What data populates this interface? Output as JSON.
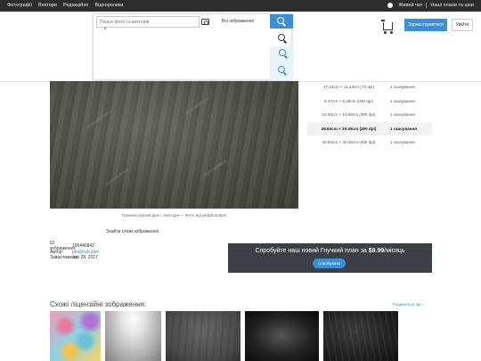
{
  "topbar": {
    "nav": [
      "Фотографії",
      "Вектори",
      "Редакційне",
      "Відеоролики"
    ],
    "chat_label": "Живий чат",
    "plans_label": "Наші плани та ціни"
  },
  "search": {
    "placeholder": "Пошук фото та векторів",
    "category": "Всі зображення"
  },
  "header": {
    "register_label": "Зареєструватися",
    "login_label": "Увійти"
  },
  "image": {
    "watermark": "depositphotos",
    "caption": "Тканина хороий фон і текстури — Фото від pedphoto3pm",
    "similar_link": "Знайти схожі зображення"
  },
  "sizes": [
    {
      "dim": "17.64cm × 11.43cm (72 dpi)",
      "dl": "1 скачування",
      "selected": false
    },
    {
      "dim": "8.47cm × 5.49cm (300 dpi)",
      "dl": "1 скачування",
      "selected": false
    },
    {
      "dim": "16.93cm × 10.98cm (300 dpi)",
      "dl": "1 скачування",
      "selected": false
    },
    {
      "dim": "46.94cm × 30.45cm (300 dpi)",
      "dl": "1 скачування",
      "selected": true
    },
    {
      "dim": "46.94cm × 30.45cm (300 dpi)",
      "dl": "1 скачування",
      "selected": false
    }
  ],
  "meta": {
    "id_label": "ID зображення:",
    "id_value": "166440842",
    "author_label": "Автор:",
    "author_value": "pedphoto3pm",
    "uploaded_label": "Завантажено:",
    "uploaded_value": "Jun 28, 2017"
  },
  "promo": {
    "text_prefix": "Спробуйте наш новий Гнучкий план за ",
    "price": "$9.99",
    "text_suffix": "/місяць",
    "button_label": "Спробувати"
  },
  "similar": {
    "title": "Схожі ліцензійні зображення:",
    "see_all": "Подивитися ще ›"
  }
}
